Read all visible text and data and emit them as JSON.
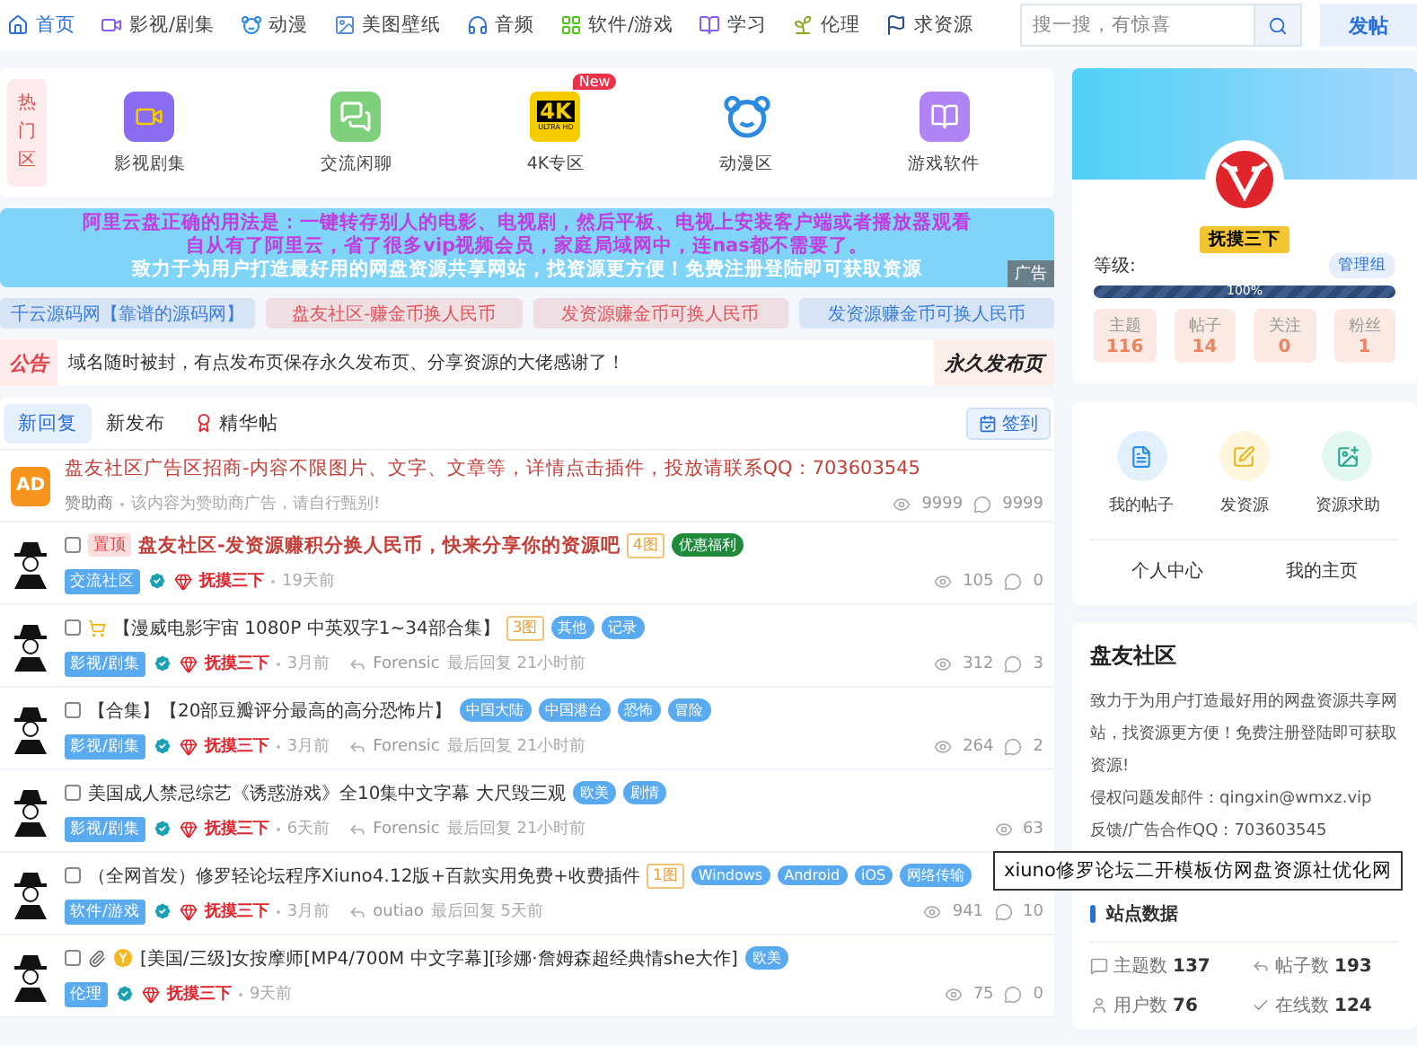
{
  "nav": {
    "items": [
      {
        "label": "首页",
        "selected": true
      },
      {
        "label": "影视/剧集",
        "selected": false
      },
      {
        "label": "动漫",
        "selected": false
      },
      {
        "label": "美图壁纸",
        "selected": false
      },
      {
        "label": "音频",
        "selected": false
      },
      {
        "label": "软件/游戏",
        "selected": false
      },
      {
        "label": "学习",
        "selected": false
      },
      {
        "label": "伦理",
        "selected": false
      },
      {
        "label": "求资源",
        "selected": false
      }
    ],
    "search": {
      "placeholder": "搜一搜，有惊喜"
    },
    "post_button": "发帖"
  },
  "hot": {
    "label": "热门区",
    "items": [
      {
        "label": "影视剧集"
      },
      {
        "label": "交流闲聊"
      },
      {
        "label": "4K专区",
        "badge": "New",
        "logo_text": "4K",
        "logo_subtext": "ULTRA HD"
      },
      {
        "label": "动漫区"
      },
      {
        "label": "游戏软件"
      }
    ]
  },
  "banner": {
    "lines": [
      "阿里云盘正确的用法是：一键转存别人的电影、电视剧，然后平板、电视上安装客户端或者播放器观看",
      "自从有了阿里云，省了很多vip视频会员，家庭局域网中，连nas都不需要了。",
      "致力于为用户打造最好用的网盘资源共享网站，找资源更方便！免费注册登陆即可获取资源"
    ],
    "tag": "广告"
  },
  "ad_links": [
    {
      "label": "千云源码网【靠谱的源码网】",
      "color": "#3b7fd9"
    },
    {
      "label": "盘友社区-赚金币换人民币",
      "color": "#e0555a"
    },
    {
      "label": "发资源赚金币可换人民币",
      "color": "#e0555a"
    },
    {
      "label": "发资源赚金币可换人民币",
      "color": "#3b7fd9"
    }
  ],
  "notice": {
    "label": "公告",
    "text": "域名随时被封，有点发布页保存永久发布页、分享资源的大佬感谢了！",
    "link": "永久发布页"
  },
  "tabs": [
    {
      "label": "新回复",
      "selected": true
    },
    {
      "label": "新发布",
      "selected": false
    },
    {
      "label": "精华帖",
      "selected": false
    }
  ],
  "checkin_button": "签到",
  "posts": [
    {
      "kind": "ad",
      "badge": "AD",
      "title": "盘友社区广告区招商-内容不限图片、文字、文章等，详情点击插件，投放请联系QQ：703603545",
      "author": "赞助商",
      "note": "该内容为赞助商广告，请自行甄别!",
      "views": "9999",
      "comments": "9999"
    },
    {
      "kind": "pinned",
      "checked": false,
      "top_label": "置顶",
      "title": "盘友社区-发资源赚积分换人民币，快来分享你的资源吧",
      "image_count": "4图",
      "tags": [
        {
          "label": "优惠福利",
          "color": "#1f8a3c"
        }
      ],
      "category": "交流社区",
      "author": "抚摸三下",
      "time": "19天前",
      "views": "105",
      "comments": "0"
    },
    {
      "kind": "normal",
      "checked": false,
      "prefix_icons": [
        {
          "kind": "cart"
        }
      ],
      "title": "【漫威电影宇宙 1080P 中英双字1~34部合集】",
      "image_count": "3图",
      "tags": [
        {
          "label": "其他",
          "color": "#5aaaf0"
        },
        {
          "label": "记录",
          "color": "#5aaaf0"
        }
      ],
      "category": "影视/剧集",
      "author": "抚摸三下",
      "time": "3月前",
      "replier": "Forensic",
      "last_reply": "最后回复 21小时前",
      "views": "312",
      "comments": "3"
    },
    {
      "kind": "normal",
      "checked": false,
      "title": "【合集】【20部豆瓣评分最高的高分恐怖片】",
      "tags": [
        {
          "label": "中国大陆",
          "color": "#5aaaf0"
        },
        {
          "label": "中国港台",
          "color": "#5aaaf0"
        },
        {
          "label": "恐怖",
          "color": "#5aaaf0"
        },
        {
          "label": "冒险",
          "color": "#5aaaf0"
        }
      ],
      "category": "影视/剧集",
      "author": "抚摸三下",
      "time": "3月前",
      "replier": "Forensic",
      "last_reply": "最后回复 21小时前",
      "views": "264",
      "comments": "2"
    },
    {
      "kind": "normal",
      "checked": false,
      "title": "美国成人禁忌综艺《诱惑游戏》全10集中文字幕 大尺毁三观",
      "tags": [
        {
          "label": "欧美",
          "color": "#5aaaf0"
        },
        {
          "label": "剧情",
          "color": "#5aaaf0"
        }
      ],
      "category": "影视/剧集",
      "author": "抚摸三下",
      "time": "6天前",
      "replier": "Forensic",
      "last_reply": "最后回复 21小时前",
      "views": "63"
    },
    {
      "kind": "normal",
      "checked": false,
      "title": "（全网首发）修罗轻论坛程序Xiuno4.12版+百款实用免费+收费插件",
      "image_count": "1图",
      "tags": [
        {
          "label": "Windows",
          "color": "#5aaaf0"
        },
        {
          "label": "Android",
          "color": "#5aaaf0"
        },
        {
          "label": "iOS",
          "color": "#5aaaf0"
        },
        {
          "label": "网络传输",
          "color": "#5aaaf0"
        }
      ],
      "category": "软件/游戏",
      "author": "抚摸三下",
      "time": "3月前",
      "replier": "outiao",
      "last_reply": "最后回复 5天前",
      "views": "941",
      "comments": "10"
    },
    {
      "kind": "normal",
      "checked": false,
      "prefix_icons": [
        {
          "kind": "clip"
        },
        {
          "kind": "coin"
        }
      ],
      "title": "[美国/三级]女按摩师[MP4/700M 中文字幕][珍娜·詹姆森超经典情she大作]",
      "tags": [
        {
          "label": "欧美",
          "color": "#5aaaf0"
        }
      ],
      "category": "伦理",
      "author": "抚摸三下",
      "time": "9天前",
      "views": "75",
      "comments": "0"
    }
  ],
  "user": {
    "name": "抚摸三下",
    "level_label": "等级:",
    "group": "管理组",
    "progress": {
      "level": 1,
      "label": "100%"
    },
    "stats": [
      {
        "label": "主题",
        "value": "116"
      },
      {
        "label": "帖子",
        "value": "14"
      },
      {
        "label": "关注",
        "value": "0"
      },
      {
        "label": "粉丝",
        "value": "1"
      }
    ]
  },
  "actions": [
    {
      "label": "我的帖子"
    },
    {
      "label": "发资源"
    },
    {
      "label": "资源求助"
    }
  ],
  "links": [
    "个人中心",
    "我的主页"
  ],
  "site": {
    "title": "盘友社区",
    "description": "致力于为用户打造最好用的网盘资源共享网站，找资源更方便！免费注册登陆即可获取资源!",
    "lines": [
      "侵权问题发邮件：qingxin@wmxz.vip",
      "反馈/广告合作QQ：703603545"
    ],
    "section": "站点数据",
    "stats": [
      {
        "label": "主题数",
        "value": "137"
      },
      {
        "label": "帖子数",
        "value": "193"
      },
      {
        "label": "用户数",
        "value": "76"
      },
      {
        "label": "在线数",
        "value": "124"
      }
    ]
  },
  "tooltip": "xiuno修罗论坛二开模板仿网盘资源社优化网"
}
